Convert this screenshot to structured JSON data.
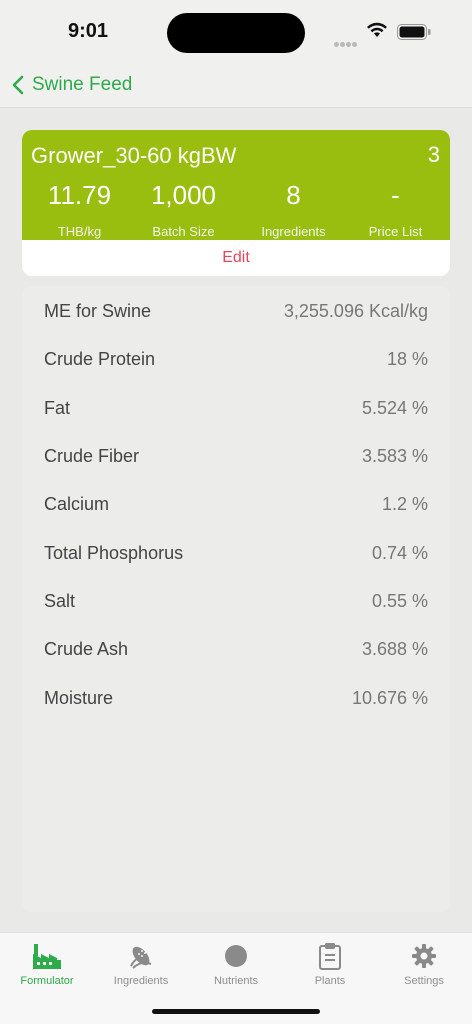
{
  "status": {
    "time": "9:01"
  },
  "nav": {
    "back_label": "Swine Feed"
  },
  "summary": {
    "name": "Grower_30-60 kgBW",
    "count": "3",
    "stats": [
      {
        "value": "11.79",
        "label": "THB/kg"
      },
      {
        "value": "1,000",
        "label": "Batch Size"
      },
      {
        "value": "8",
        "label": "Ingredients"
      },
      {
        "value": "-",
        "label": "Price List"
      }
    ],
    "edit_label": "Edit"
  },
  "nutrients": [
    {
      "name": "ME for Swine",
      "value": "3,255.096 Kcal/kg"
    },
    {
      "name": "Crude Protein",
      "value": "18 %"
    },
    {
      "name": "Fat",
      "value": "5.524 %"
    },
    {
      "name": "Crude Fiber",
      "value": "3.583 %"
    },
    {
      "name": "Calcium",
      "value": "1.2 %"
    },
    {
      "name": "Total Phosphorus",
      "value": "0.74 %"
    },
    {
      "name": "Salt",
      "value": "0.55 %"
    },
    {
      "name": "Crude Ash",
      "value": "3.688 %"
    },
    {
      "name": "Moisture",
      "value": "10.676 %"
    }
  ],
  "tabs": [
    {
      "label": "Formulator",
      "icon": "factory-icon",
      "active": true
    },
    {
      "label": "Ingredients",
      "icon": "corn-icon",
      "active": false
    },
    {
      "label": "Nutrients",
      "icon": "circle-icon",
      "active": false
    },
    {
      "label": "Plants",
      "icon": "clipboard-icon",
      "active": false
    },
    {
      "label": "Settings",
      "icon": "gear-icon",
      "active": false
    }
  ],
  "colors": {
    "accent": "#2eab4b",
    "card_green": "#9abe0f",
    "edit_red": "#e4475b"
  }
}
